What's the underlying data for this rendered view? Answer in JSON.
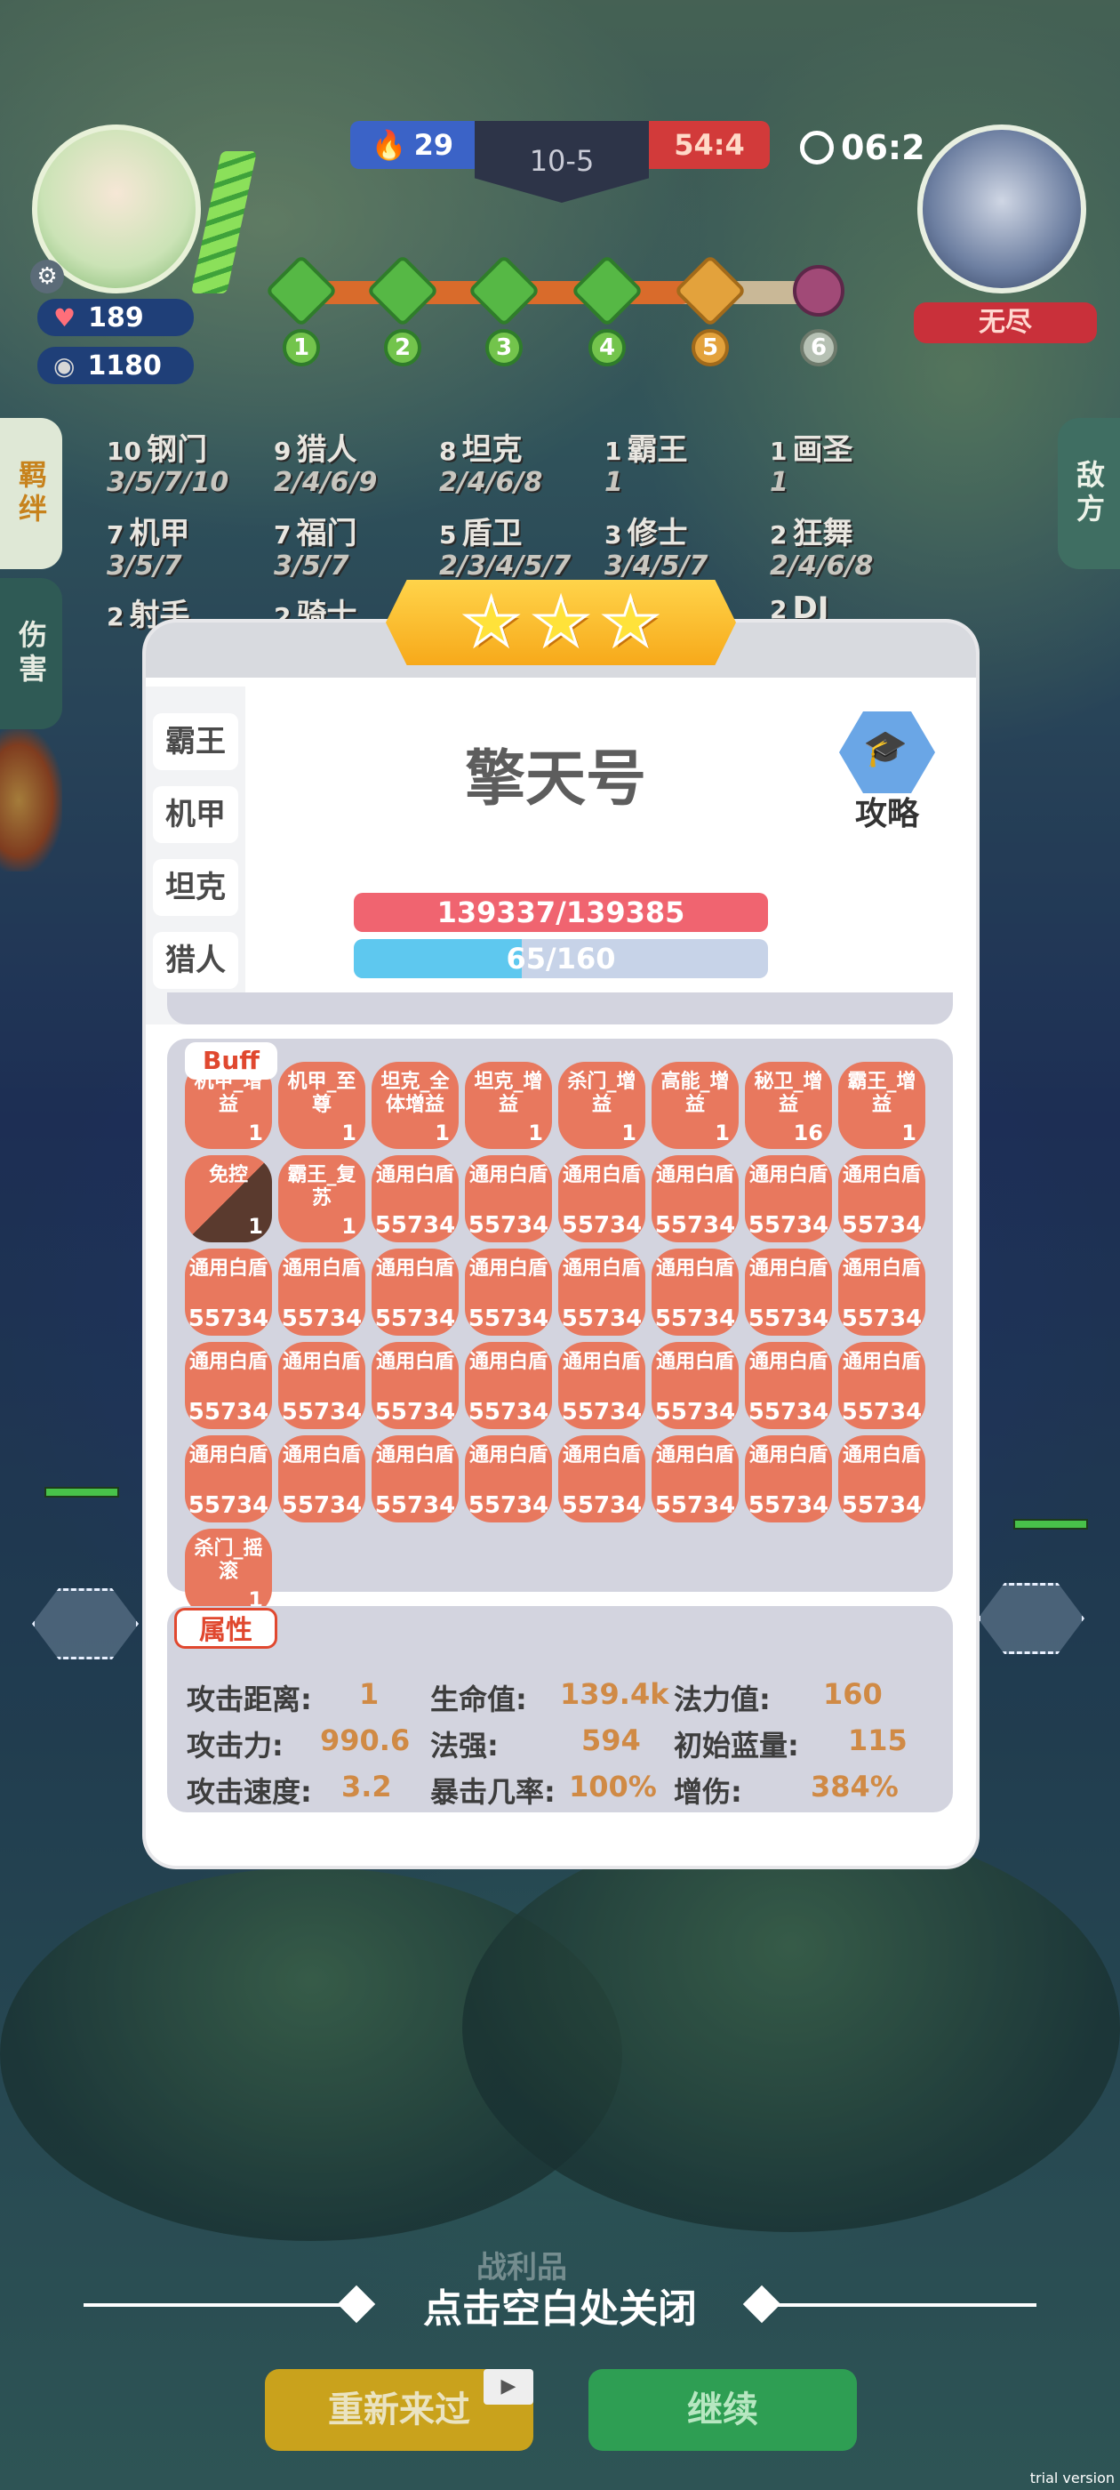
{
  "hud": {
    "hp": "189",
    "gold": "1180",
    "blue_score": "29",
    "stage": "10-5",
    "red_score": "54:4",
    "timer": "06:2",
    "enemy_label": "无尽",
    "stage_nodes": [
      "1",
      "2",
      "3",
      "4",
      "5",
      "6"
    ]
  },
  "side_tabs": {
    "left_active": "羁绊",
    "left_inactive": "伤害",
    "right": "敌方"
  },
  "traits": [
    {
      "count": "10",
      "name": "钢门",
      "levels": "3/5/7/10"
    },
    {
      "count": "9",
      "name": "猎人",
      "levels": "2/4/6/9"
    },
    {
      "count": "8",
      "name": "坦克",
      "levels": "2/4/6/8"
    },
    {
      "count": "1",
      "name": "霸王",
      "levels": "1"
    },
    {
      "count": "1",
      "name": "画圣",
      "levels": "1"
    },
    {
      "count": "7",
      "name": "机甲",
      "levels": "3/5/7"
    },
    {
      "count": "7",
      "name": "福门",
      "levels": "3/5/7"
    },
    {
      "count": "5",
      "name": "盾卫",
      "levels": "2/3/4/5/7"
    },
    {
      "count": "3",
      "name": "修士",
      "levels": "3/4/5/7"
    },
    {
      "count": "2",
      "name": "狂舞",
      "levels": "2/4/6/8"
    },
    {
      "count": "2",
      "name": "射手",
      "levels": ""
    },
    {
      "count": "2",
      "name": "骑士",
      "levels": ""
    },
    {
      "count": "2",
      "name": "DJ",
      "levels": ""
    }
  ],
  "modal": {
    "stars": [
      "★",
      "★",
      "★"
    ],
    "trait_tabs": [
      "霸王",
      "机甲",
      "坦克",
      "猎人"
    ],
    "unit_name": "擎天号",
    "strategy_label": "攻略",
    "hp_text": "139337/139385",
    "mp_text": "65/160",
    "mp_fraction": 0.406,
    "buff_title": "Buff",
    "attr_title": "属性"
  },
  "buffs": [
    {
      "name": "机甲_增益",
      "stack": "1"
    },
    {
      "name": "机甲_至尊",
      "stack": "1"
    },
    {
      "name": "坦克_全体增益",
      "stack": "1"
    },
    {
      "name": "坦克_增益",
      "stack": "1"
    },
    {
      "name": "杀门_增益",
      "stack": "1"
    },
    {
      "name": "高能_增益",
      "stack": "1"
    },
    {
      "name": "秘卫_增益",
      "stack": "16"
    },
    {
      "name": "霸王_增益",
      "stack": "1"
    },
    {
      "name": "免控",
      "stack": "1"
    },
    {
      "name": "霸王_复苏",
      "stack": "1"
    },
    {
      "name": "通用白盾",
      "stack": "55734"
    },
    {
      "name": "通用白盾",
      "stack": "55734"
    },
    {
      "name": "通用白盾",
      "stack": "55734"
    },
    {
      "name": "通用白盾",
      "stack": "55734"
    },
    {
      "name": "通用白盾",
      "stack": "55734"
    },
    {
      "name": "通用白盾",
      "stack": "55734"
    },
    {
      "name": "通用白盾",
      "stack": "55734"
    },
    {
      "name": "通用白盾",
      "stack": "55734"
    },
    {
      "name": "通用白盾",
      "stack": "55734"
    },
    {
      "name": "通用白盾",
      "stack": "55734"
    },
    {
      "name": "通用白盾",
      "stack": "55734"
    },
    {
      "name": "通用白盾",
      "stack": "55734"
    },
    {
      "name": "通用白盾",
      "stack": "55734"
    },
    {
      "name": "通用白盾",
      "stack": "55734"
    },
    {
      "name": "通用白盾",
      "stack": "55734"
    },
    {
      "name": "通用白盾",
      "stack": "55734"
    },
    {
      "name": "通用白盾",
      "stack": "55734"
    },
    {
      "name": "通用白盾",
      "stack": "55734"
    },
    {
      "name": "通用白盾",
      "stack": "55734"
    },
    {
      "name": "通用白盾",
      "stack": "55734"
    },
    {
      "name": "通用白盾",
      "stack": "55734"
    },
    {
      "name": "通用白盾",
      "stack": "55734"
    },
    {
      "name": "通用白盾",
      "stack": "55734"
    },
    {
      "name": "通用白盾",
      "stack": "55734"
    },
    {
      "name": "通用白盾",
      "stack": "55734"
    },
    {
      "name": "通用白盾",
      "stack": "55734"
    },
    {
      "name": "通用白盾",
      "stack": "55734"
    },
    {
      "name": "通用白盾",
      "stack": "55734"
    },
    {
      "name": "通用白盾",
      "stack": "55734"
    },
    {
      "name": "通用白盾",
      "stack": "55734"
    },
    {
      "name": "杀门_摇滚",
      "stack": "1"
    }
  ],
  "attributes": [
    {
      "label": "攻击距离:",
      "value": "1"
    },
    {
      "label": "生命值:",
      "value": "139.4k"
    },
    {
      "label": "法力值:",
      "value": "160"
    },
    {
      "label": "攻击力:",
      "value": "990.6"
    },
    {
      "label": "法强:",
      "value": "594"
    },
    {
      "label": "初始蓝量:",
      "value": "115"
    },
    {
      "label": "攻击速度:",
      "value": "3.2"
    },
    {
      "label": "暴击几率:",
      "value": "100%"
    },
    {
      "label": "增伤:",
      "value": "384%"
    }
  ],
  "footer": {
    "spoils_label": "战利品",
    "close_hint": "点击空白处关闭",
    "retry_label": "重新来过",
    "continue_label": "继续",
    "watermark": "trial version"
  },
  "colors": {
    "accent_orange": "#e8785e",
    "hp_red": "#f06470",
    "mp_blue": "#5ec8ef",
    "continue_green": "#2e9e53",
    "retry_gold": "#c9a21c"
  }
}
